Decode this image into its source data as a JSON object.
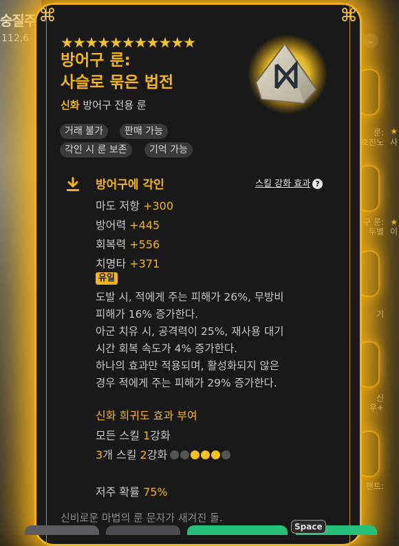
{
  "background": {
    "left_title": "숭질주",
    "left_number": "112,6",
    "right_labels": [
      "룬:",
      "호진노",
      "사",
      "구 룬:",
      "두별",
      "이",
      "기",
      "신",
      "우+",
      "팬트:"
    ]
  },
  "item": {
    "stars": "★★★★★★★★★★★",
    "title_line1": "방어구 룬:",
    "title_line2": "사슬로 묶은 법전",
    "rarity": "신화",
    "type": "방어구 전용 룬",
    "tags": [
      "거래 불가",
      "판매 가능",
      "각인 시 룬 보존",
      "기억 가능"
    ]
  },
  "engrave": {
    "title": "방어구에 각인",
    "skill_link": "스킬 강화 효과",
    "help": "?",
    "stats": [
      {
        "name": "마도 저항 ",
        "value": "+300"
      },
      {
        "name": "방어력 ",
        "value": "+445"
      },
      {
        "name": "회복력 ",
        "value": "+556"
      },
      {
        "name": "치명타 ",
        "value": "+371"
      }
    ]
  },
  "unique": {
    "badge": "유일",
    "lines": [
      "도발 시, 적에게 주는 피해가 26%, 무방비",
      "피해가 16% 증가한다.",
      "아군 치유 시, 공격력이 25%, 재사용 대기",
      "시간 회복 속도가 4% 증가한다.",
      "하나의 효과만 적용되며, 활성화되지 않은",
      "경우 적에게 주는 피해가 29% 증가한다."
    ]
  },
  "mythic_grant": {
    "title": "신화 희귀도 효과 부여",
    "line1_a": "모든 스킬 ",
    "line1_v": "1",
    "line1_b": "강화",
    "line2_v1": "3",
    "line2_a": "개 스킬 ",
    "line2_v2": "2",
    "line2_b": "강화",
    "pips_filled": [
      false,
      false,
      true,
      true,
      true,
      false
    ]
  },
  "curse": {
    "label": "저주 확률 ",
    "value": "75%"
  },
  "flavor": "신비로운 마법의 룬 문자가 새겨진 돌.",
  "hotkey": "Space",
  "colors": {
    "accent": "#f3b51b",
    "frame": "#f2b21e",
    "panel": "#191919",
    "button_green": "#27c07a"
  }
}
